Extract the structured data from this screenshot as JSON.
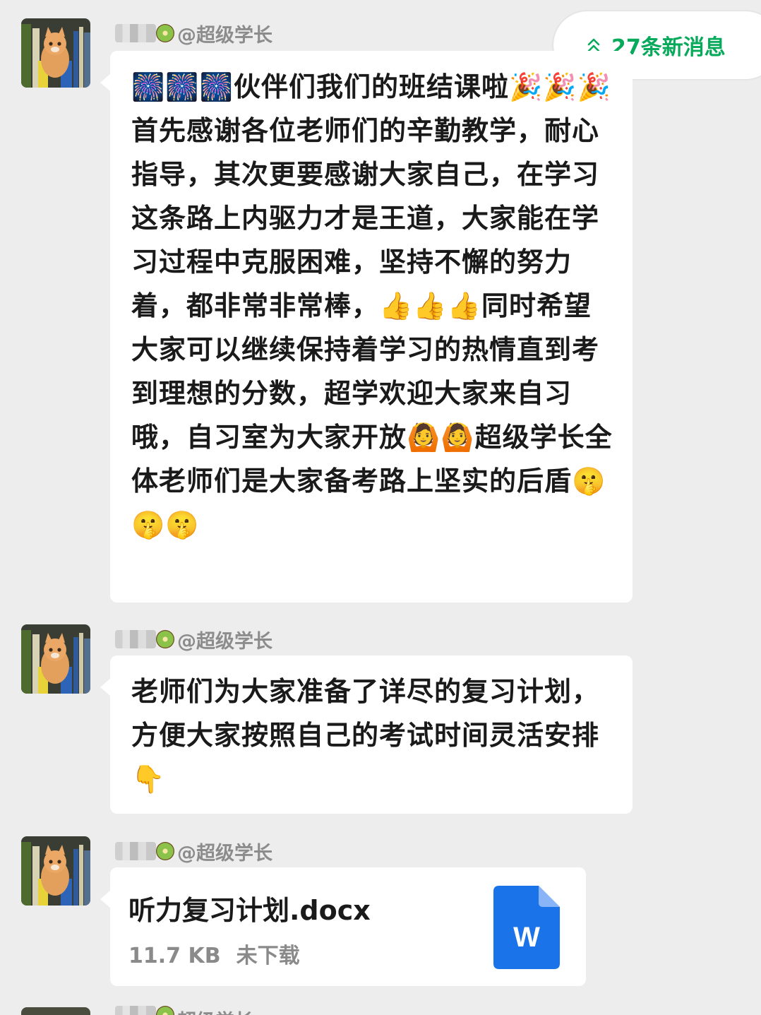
{
  "new_messages": {
    "label": "27条新消息"
  },
  "messages": [
    {
      "sender": "@超级学长",
      "text_parts": [
        "🎆🎆🎆伙伴们我们的班结课啦🎉🎉🎉\n首先感谢各位老师们的辛勤教学，耐心指导，其次更要感谢大家自己，在学习这条路上内驱力才是王道，大家能在学习过程中克服困难，坚持不懈的努力着，都非常非常棒，",
        "👍👍👍",
        "同时希望大家可以继续保持着学习的热情直到考到理想的分数，超学欢迎大家来自习哦，自习室为大家开放",
        "🙆🙆",
        "超级学长全体老师们是大家备考路上坚实的后盾",
        "🤫🤫🤫"
      ]
    },
    {
      "sender": "@超级学长",
      "text": "老师们为大家准备了详尽的复习计划，方便大家按照自己的考试时间灵活安排",
      "emoji": "👇"
    },
    {
      "sender": "@超级学长",
      "file": {
        "name": "听力复习计划.docx",
        "size": "11.7 KB",
        "status": "未下载",
        "icon_letter": "W"
      }
    },
    {
      "sender": "超级学长"
    }
  ],
  "colors": {
    "accent": "#07a95a",
    "background": "#ededed",
    "word_blue": "#1a73e8"
  },
  "icons": [
    "double-chevron-up-icon",
    "cat-avatar",
    "kiwi-emoji-icon",
    "word-doc-icon"
  ]
}
